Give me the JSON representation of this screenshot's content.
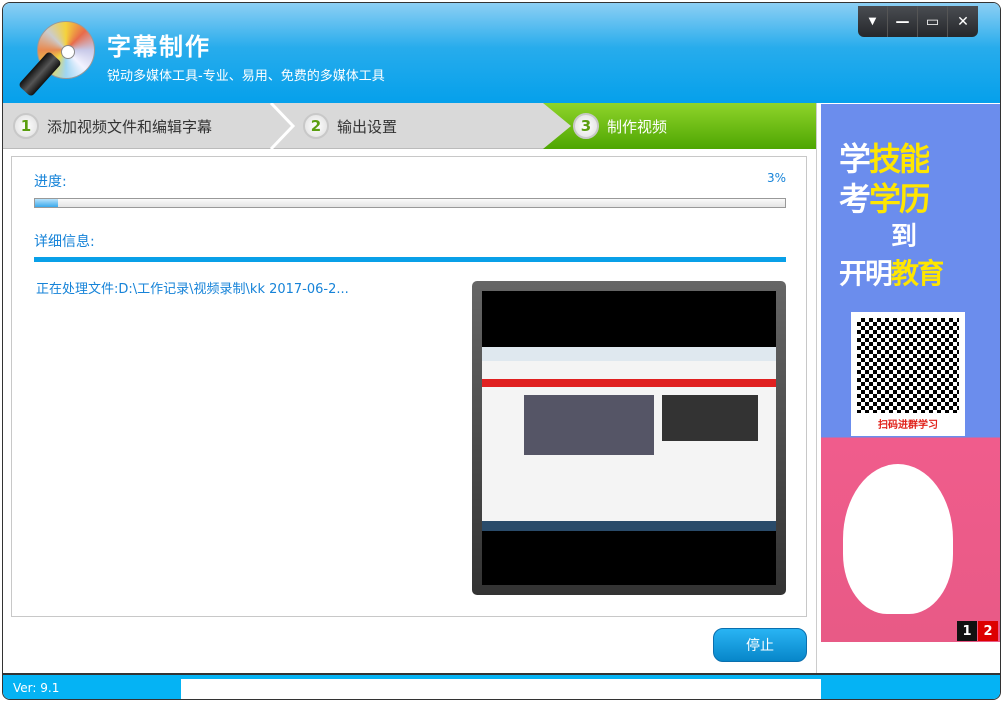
{
  "header": {
    "title": "字幕制作",
    "subtitle": "锐动多媒体工具-专业、易用、免费的多媒体工具"
  },
  "window_controls": {
    "menu": "▼",
    "minimize": "—",
    "maximize": "▭",
    "close": "✕"
  },
  "steps": [
    {
      "num": "1",
      "label": "添加视频文件和编辑字幕"
    },
    {
      "num": "2",
      "label": "输出设置"
    },
    {
      "num": "3",
      "label": "制作视频",
      "active": true
    }
  ],
  "progress": {
    "label": "进度:",
    "percent_text": "3%",
    "value": 3
  },
  "details": {
    "label": "详细信息:",
    "processing_text": "正在处理文件:D:\\工作记录\\视频录制\\kk 2017-06-2..."
  },
  "stop_button": "停止",
  "ad": {
    "line1": "学技能",
    "line2": "考学历",
    "line3": "到",
    "line4": "开明教育",
    "qr_caption": "扫码进群学习",
    "pages": [
      "1",
      "2"
    ],
    "active_page": "2"
  },
  "footer": {
    "version": "Ver: 9.1"
  },
  "colors": {
    "accent": "#09a0e8",
    "active_step": "#6cc214",
    "stop_button": "#1a9ee0"
  }
}
